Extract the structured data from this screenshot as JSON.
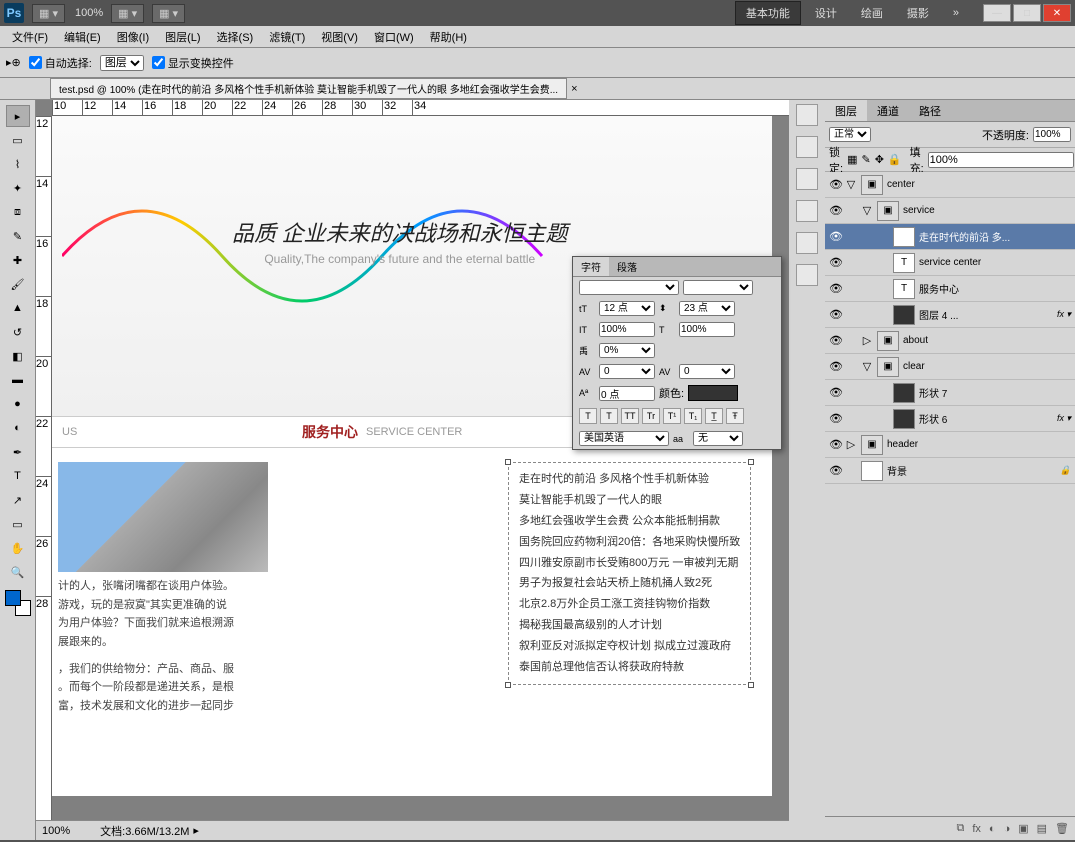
{
  "topbar": {
    "logo": "Ps",
    "zoom": "100%",
    "workspaces": [
      "基本功能",
      "设计",
      "绘画",
      "摄影"
    ]
  },
  "menu": [
    "文件(F)",
    "编辑(E)",
    "图像(I)",
    "图层(L)",
    "选择(S)",
    "滤镜(T)",
    "视图(V)",
    "窗口(W)",
    "帮助(H)"
  ],
  "optbar": {
    "auto": "自动选择:",
    "layer": "图层",
    "show": "显示变换控件"
  },
  "tab": {
    "title": "test.psd @ 100% (走在时代的前沿 多风格个性手机新体验 莫让智能手机毁了一代人的眼 多地红会强收学生会费...",
    "x": "×"
  },
  "ruler_h": [
    "10",
    "12",
    "14",
    "16",
    "18",
    "20",
    "22",
    "24",
    "26",
    "28",
    "30",
    "32",
    "34"
  ],
  "ruler_v": [
    "12",
    "14",
    "16",
    "18",
    "20",
    "22",
    "24",
    "26",
    "28"
  ],
  "banner": {
    "zh": "品质 企业未来的决战场和永恒主题",
    "en": "Quality,The company's future and the eternal battle"
  },
  "divider": {
    "red": "服务中心",
    "gray": "SERVICE CENTER",
    "us": "US"
  },
  "para": [
    "计的人，张嘴闭嘴都在谈用户体验。",
    "游戏，玩的是寂寞\"其实更准确的说",
    "为用户体验？下面我们就来追根溯源",
    "展跟来的。",
    "，我们的供给物分：产品、商品、服",
    "。而每个一阶段都是递进关系，是根",
    "富，技术发展和文化的进步一起同步"
  ],
  "list": [
    "走在时代的前沿 多风格个性手机新体验",
    "莫让智能手机毁了一代人的眼",
    "多地红会强收学生会费 公众本能抵制捐款",
    "国务院回应药物利润20倍：各地采购快慢所致",
    "四川雅安原副市长受贿800万元 一审被判无期",
    "男子为报复社会站天桥上随机捅人致2死",
    "北京2.8万外企员工涨工资挂钩物价指数",
    "揭秘我国最高级别的人才计划",
    "叙利亚反对派拟定夺权计划 拟成立过渡政府",
    "泰国前总理他信否认将获政府特赦"
  ],
  "status": {
    "zoom": "100%",
    "doc": "文档:3.66M/13.2M"
  },
  "layerspanel": {
    "tabs": [
      "图层",
      "通道",
      "路径"
    ],
    "blend": "正常",
    "opacity_l": "不透明度:",
    "opacity": "100%",
    "lock": "锁定:",
    "fill_l": "填充:",
    "fill": "100%",
    "layers": [
      {
        "ind": 0,
        "arr": "▽",
        "thumb": "folder",
        "name": "center"
      },
      {
        "ind": 1,
        "arr": "▽",
        "thumb": "folder",
        "name": "service"
      },
      {
        "ind": 2,
        "thumb": "T",
        "name": "走在时代的前沿 多...",
        "sel": true
      },
      {
        "ind": 2,
        "thumb": "T",
        "name": "service center"
      },
      {
        "ind": 2,
        "thumb": "T",
        "name": "服务中心"
      },
      {
        "ind": 2,
        "thumb": "shape",
        "name": "图层 4 ...",
        "fx": "fx ▾"
      },
      {
        "ind": 1,
        "arr": "▷",
        "thumb": "folder",
        "name": "about"
      },
      {
        "ind": 1,
        "arr": "▽",
        "thumb": "folder",
        "name": "clear"
      },
      {
        "ind": 2,
        "thumb": "shape",
        "name": "形状 7"
      },
      {
        "ind": 2,
        "thumb": "shape",
        "name": "形状 6",
        "fx": "fx ▾"
      },
      {
        "ind": 0,
        "arr": "▷",
        "thumb": "folder",
        "name": "header"
      },
      {
        "ind": 0,
        "thumb": "white",
        "name": "背景",
        "lock": true
      }
    ]
  },
  "charpanel": {
    "tabs": [
      "字符",
      "段落"
    ],
    "size": "12 点",
    "leading": "23 点",
    "vscale": "100%",
    "hscale": "100%",
    "tracking": "0%",
    "kern": "0",
    "baseline": "0 点",
    "color_l": "颜色:",
    "lang": "美国英语",
    "aa": "无"
  }
}
